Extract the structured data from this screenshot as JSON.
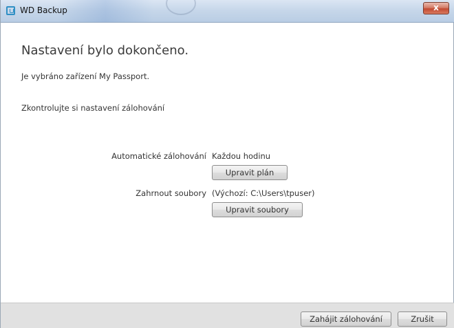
{
  "window": {
    "title": "WD Backup",
    "close_glyph": "x"
  },
  "content": {
    "heading": "Nastavení bylo dokončeno.",
    "selected_device": "Je vybráno zařízení My Passport.",
    "review_prompt": "Zkontrolujte si nastavení zálohování",
    "auto_backup": {
      "label": "Automatické zálohování",
      "value": "Každou hodinu",
      "button": "Upravit plán"
    },
    "include_files": {
      "label": "Zahrnout soubory",
      "value": "(Výchozí: C:\\Users\\tpuser)",
      "button": "Upravit soubory"
    }
  },
  "footer": {
    "start_button": "Zahájit zálohování",
    "cancel_button": "Zrušit"
  }
}
